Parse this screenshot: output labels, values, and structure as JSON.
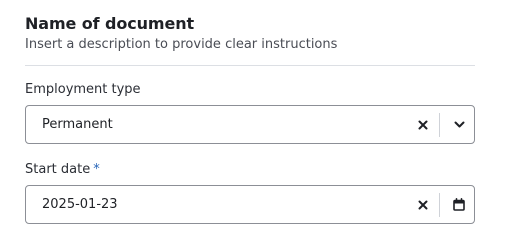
{
  "header": {
    "title": "Name of document",
    "description": "Insert a description to provide clear instructions"
  },
  "fields": {
    "employment_type": {
      "label": "Employment type",
      "value": "Permanent"
    },
    "start_date": {
      "label": "Start date",
      "required_marker": "*",
      "value": "2025-01-23"
    }
  },
  "icons": {
    "clear": "close-icon",
    "dropdown": "chevron-down-icon",
    "calendar": "calendar-icon"
  },
  "colors": {
    "text": "#1f2126",
    "required_marker": "#2563b8",
    "border": "#8c8f96"
  }
}
